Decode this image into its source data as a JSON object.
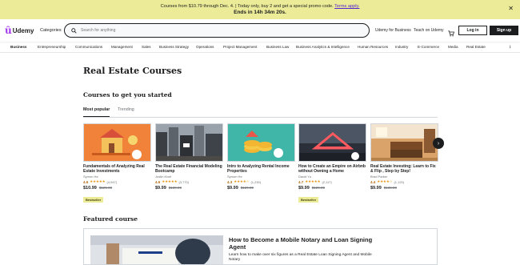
{
  "promo": {
    "line1": "Courses from $10.79 through Dec. 4. | Today only, buy 2 and get a special promo code.",
    "link": "Terms apply.",
    "line2": "Ends in 14h 34m 20s.",
    "close": "✕"
  },
  "header": {
    "logo": "Udemy",
    "categories": "Categories",
    "search_placeholder": "Search for anything",
    "udemy_business": "Udemy for Business",
    "teach": "Teach on Udemy",
    "login": "Log in",
    "signup": "Sign up"
  },
  "catnav": [
    "Business",
    "Entrepreneurship",
    "Communications",
    "Management",
    "Sales",
    "Business Strategy",
    "Operations",
    "Project Management",
    "Business Law",
    "Business Analytics & Intelligence",
    "Human Resources",
    "Industry",
    "E-Commerce",
    "Media",
    "Real Estate"
  ],
  "catnav_more": "⋮",
  "page": {
    "title": "Real Estate Courses",
    "subtitle": "Courses to get you started",
    "tabs": [
      "Most popular",
      "Trending"
    ]
  },
  "courses": [
    {
      "title": "Fundamentals of Analyzing Real Estate Investments",
      "author": "Symon He",
      "rating": "4.6",
      "stars": "★★★★★",
      "count": "(4,947)",
      "price": "$10.99",
      "original": "$129.99",
      "badge": "Bestseller"
    },
    {
      "title": "The Real Estate Financial Modeling Bootcamp",
      "author": "Justin Kivel",
      "rating": "4.6",
      "stars": "★★★★★",
      "count": "(3,770)",
      "price": "$9.99",
      "original": "$139.99",
      "badge": ""
    },
    {
      "title": "Intro to Analyzing Rental Income Properties",
      "author": "Symon He",
      "rating": "4.3",
      "stars": "★★★★☆",
      "count": "(1,230)",
      "price": "$9.99",
      "original": "$129.99",
      "badge": ""
    },
    {
      "title": "How to Create an Empire on Airbnb without Owning a Home",
      "author": "David Yu",
      "rating": "4.7",
      "stars": "★★★★★",
      "count": "(2,117)",
      "price": "$9.99",
      "original": "$129.99",
      "badge": "Bestseller"
    },
    {
      "title": "Real Estate Investing: Learn to Fix & Flip , Step by Step!",
      "author": "Brad Parker",
      "rating": "4.4",
      "stars": "★★★★☆",
      "count": "(1,120)",
      "price": "$9.99",
      "original": "$139.99",
      "badge": ""
    }
  ],
  "next_arrow": "›",
  "featured": {
    "heading": "Featured course",
    "title": "How to Become a Mobile Notary and Loan Signing Agent",
    "desc": "Learn how to make over six figures as a Real Estate Loan Signing Agent and Mobile Notary"
  }
}
